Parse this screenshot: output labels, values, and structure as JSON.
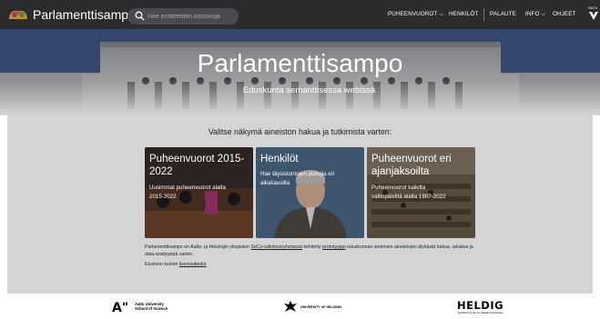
{
  "header": {
    "app_title": "Parlamenttisampo",
    "search_placeholder": "Hae entiteettien kotisivuja",
    "nav": [
      {
        "label": "PUHEENVUOROT",
        "dropdown": true
      },
      {
        "label": "HENKILÖT",
        "dropdown": false
      },
      {
        "label": "PALAUTE",
        "dropdown": false
      },
      {
        "label": "INFO",
        "dropdown": true
      },
      {
        "label": "OHJEET",
        "dropdown": false
      }
    ],
    "seco_label": "SeCo"
  },
  "hero": {
    "title": "Parlamenttisampo",
    "subtitle": "Eduskunta semanttisessa webissä"
  },
  "main": {
    "lead": "Valitse näkymä aineiston hakua ja tutkimista varten:",
    "cards": [
      {
        "title_line1": "Puheenvuorot 2015-",
        "title_line2": "2022",
        "desc_line1": "Uusimmat puheenvuorot alalta",
        "desc_line2": "2015-2022"
      },
      {
        "title_line1": "Henkilöt",
        "title_line2": "",
        "desc_line1": "Hae täysistuntojen puhujia eri",
        "desc_line2": "aikakausilta"
      },
      {
        "title_line1": "Puheenvuorot eri",
        "title_line2": "ajanjaksoilta",
        "desc_line1": "Puheenvuorot kaikilta",
        "desc_line2": "valtiopäiviltä alalta 1907-2022"
      }
    ],
    "about": {
      "part1": "Parlamenttisampo on Aalto- ja Helsingin yliopiston ",
      "link1": "SeCo-tutkimusryhmässä",
      "part2": " kehitetty ",
      "link2": "prototyyppi",
      "part3": " eduskunnan avoimien aineistojen älykästä hakua, selailua ja",
      "line2": "data-analyysejä varten.",
      "privacy_prefix": "Etusivun kuvien ",
      "privacy_link": "lisenssitiedot"
    }
  },
  "footer": {
    "aalto_mark": "A\"",
    "aalto_line1": "Aalto University",
    "aalto_line2": "School of Science",
    "helsinki_text": "UNIVERSITY OF HELSINKI",
    "heldig_title": "HELDIG",
    "heldig_sub": "Helsinki Centre for Digital Humanities"
  },
  "colors": {
    "topbar": "#2c2b2e",
    "main_bg": "#d4d4d4",
    "hero_sky": "#2b3d63"
  }
}
